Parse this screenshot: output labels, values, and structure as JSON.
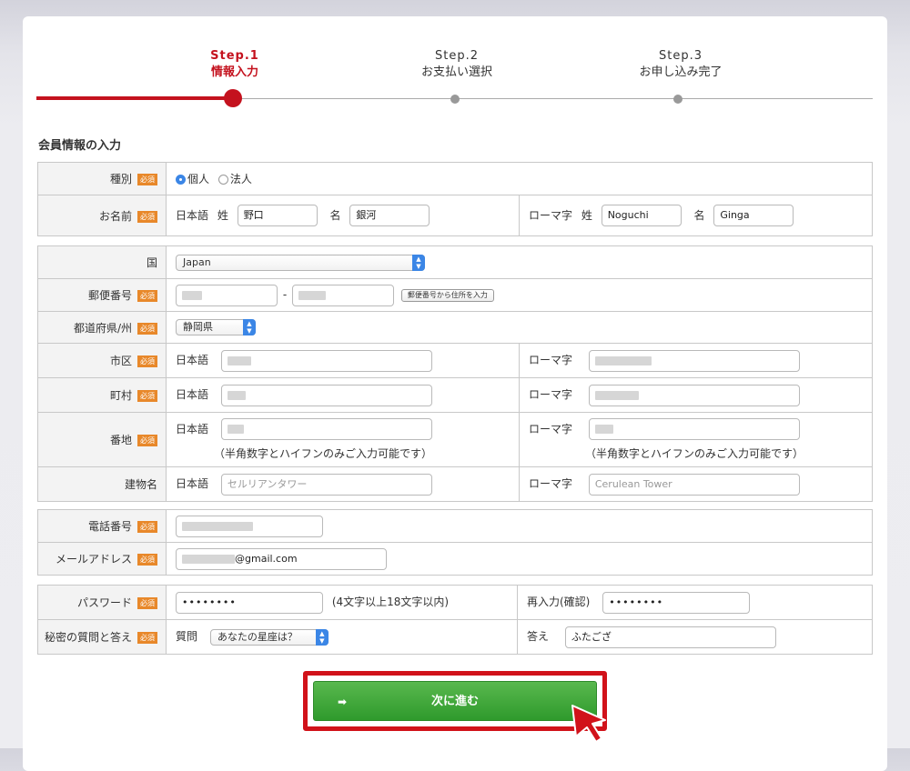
{
  "steps": [
    {
      "num": "Step.1",
      "label": "情報入力"
    },
    {
      "num": "Step.2",
      "label": "お支払い選択"
    },
    {
      "num": "Step.3",
      "label": "お申し込み完了"
    }
  ],
  "section_title": "会員情報の入力",
  "required_badge": "必須",
  "labels": {
    "type": "種別",
    "name": "お名前",
    "country": "国",
    "postal": "郵便番号",
    "prefecture": "都道府県/州",
    "city": "市区",
    "town": "町村",
    "street": "番地",
    "building": "建物名",
    "phone": "電話番号",
    "email": "メールアドレス",
    "password": "パスワード",
    "secret": "秘密の質問と答え"
  },
  "sub": {
    "japanese": "日本語",
    "romaji": "ローマ字",
    "sei": "姓",
    "mei": "名",
    "reentry": "再入力(確認)",
    "question": "質問",
    "answer": "答え"
  },
  "type_options": [
    "個人",
    "法人"
  ],
  "name": {
    "sei_jp": "野口",
    "mei_jp": "銀河",
    "sei_en": "Noguchi",
    "mei_en": "Ginga"
  },
  "country_value": "Japan",
  "postal_button": "郵便番号から住所を入力",
  "prefecture_value": "静岡県",
  "street_note": "（半角数字とハイフンのみご入力可能です）",
  "building_placeholder_jp": "セルリアンタワー",
  "building_placeholder_en": "Cerulean Tower",
  "email_domain": "@gmail.com",
  "password_mask": "••••••••",
  "password_note": "(4文字以上18文字以内)",
  "question_value": "あなたの星座は？",
  "answer_value": "ふたござ",
  "submit_label": "次に進む",
  "submit_arrow": "➡",
  "postal_dash": "-",
  "colors": {
    "accent": "#c4121e",
    "required": "#e8882a",
    "submit": "#3a9f35"
  }
}
